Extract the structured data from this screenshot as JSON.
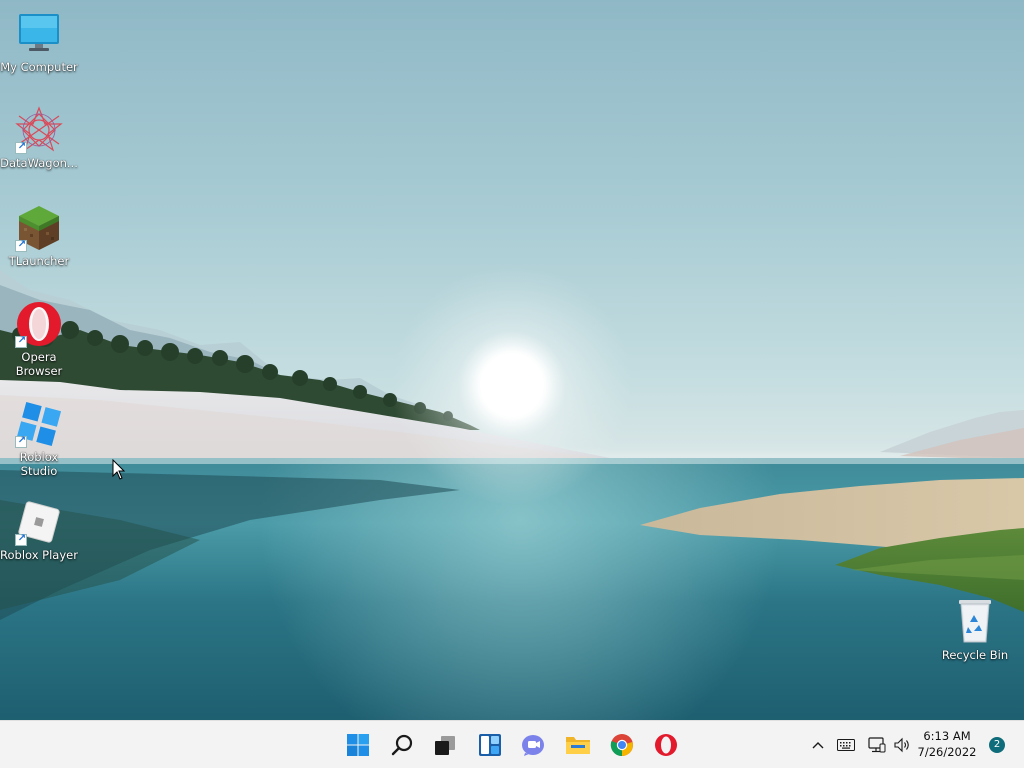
{
  "desktop": {
    "icons": [
      {
        "label": "My Computer",
        "icon": "monitor-icon",
        "shortcut": false
      },
      {
        "label": "DataWagon...",
        "icon": "datawagon-icon",
        "shortcut": true
      },
      {
        "label": "TLauncher",
        "icon": "grass-block-icon",
        "shortcut": true
      },
      {
        "label": "Opera Browser",
        "icon": "opera-icon",
        "shortcut": true
      },
      {
        "label": "Roblox Studio",
        "icon": "roblox-studio-icon",
        "shortcut": true
      },
      {
        "label": "Roblox Player",
        "icon": "roblox-player-icon",
        "shortcut": true
      }
    ],
    "recycle_bin": {
      "label": "Recycle Bin",
      "icon": "recycle-bin-icon"
    }
  },
  "taskbar": {
    "pinned": [
      {
        "name": "start",
        "icon": "windows-start-icon"
      },
      {
        "name": "search",
        "icon": "search-icon"
      },
      {
        "name": "task-view",
        "icon": "task-view-icon"
      },
      {
        "name": "widgets",
        "icon": "widgets-icon"
      },
      {
        "name": "chat",
        "icon": "teams-chat-icon"
      },
      {
        "name": "file-explorer",
        "icon": "folder-icon"
      },
      {
        "name": "chrome",
        "icon": "chrome-icon"
      },
      {
        "name": "opera",
        "icon": "opera-icon"
      }
    ],
    "tray": {
      "chevron_icon": "chevron-up-icon",
      "keyboard_icon": "keyboard-icon",
      "network_icon": "network-icon",
      "volume_icon": "volume-icon",
      "time": "6:13 AM",
      "date": "7/26/2022",
      "notification_count": "2"
    }
  },
  "colors": {
    "accent": "#0f6c7a",
    "taskbar_bg": "#f3f3f3",
    "windows_blue": "#1f8ee6",
    "opera_red": "#e3192c"
  }
}
